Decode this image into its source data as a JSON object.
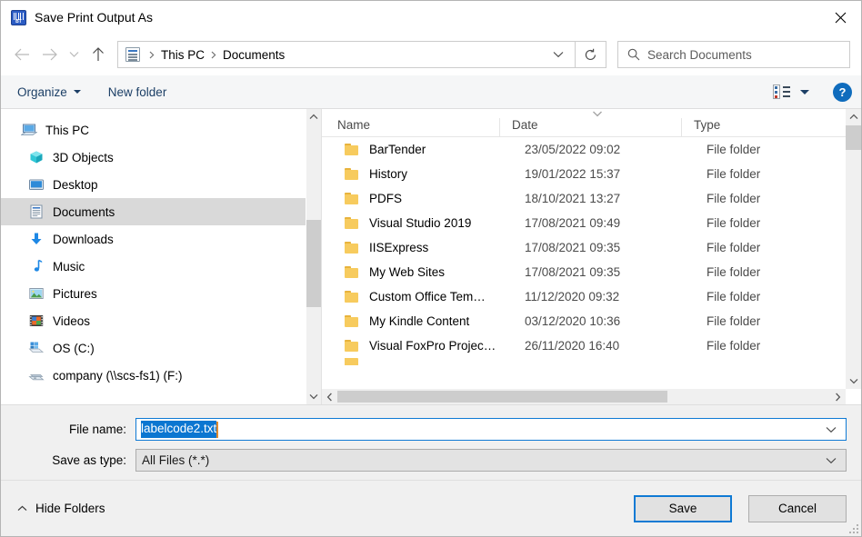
{
  "window": {
    "title": "Save Print Output As",
    "icon": "bartender-icon",
    "close_label": "✕"
  },
  "nav": {
    "back_icon": "arrow-left-icon",
    "forward_icon": "arrow-right-icon",
    "recent_icon": "chevron-down-icon",
    "up_icon": "arrow-up-icon",
    "breadcrumb": {
      "folder_icon": "documents-icon",
      "items": [
        "This PC",
        "Documents"
      ],
      "separator": "›",
      "dropdown_icon": "chevron-down-icon"
    },
    "refresh_icon": "refresh-icon",
    "search": {
      "icon": "search-icon",
      "placeholder": "Search Documents",
      "value": ""
    }
  },
  "toolbar": {
    "organize_label": "Organize",
    "new_folder_label": "New folder",
    "view_icon": "details-view-icon",
    "view_dropdown_icon": "chevron-down-icon",
    "help_label": "?"
  },
  "sidebar": {
    "items": [
      {
        "label": "This PC",
        "icon": "this-pc-icon",
        "selected": false,
        "root": true
      },
      {
        "label": "3D Objects",
        "icon": "3d-objects-icon",
        "selected": false,
        "root": false
      },
      {
        "label": "Desktop",
        "icon": "desktop-icon",
        "selected": false,
        "root": false
      },
      {
        "label": "Documents",
        "icon": "documents-icon",
        "selected": true,
        "root": false
      },
      {
        "label": "Downloads",
        "icon": "downloads-icon",
        "selected": false,
        "root": false
      },
      {
        "label": "Music",
        "icon": "music-icon",
        "selected": false,
        "root": false
      },
      {
        "label": "Pictures",
        "icon": "pictures-icon",
        "selected": false,
        "root": false
      },
      {
        "label": "Videos",
        "icon": "videos-icon",
        "selected": false,
        "root": false
      },
      {
        "label": "OS (C:)",
        "icon": "local-disk-icon",
        "selected": false,
        "root": false
      },
      {
        "label": "company (\\\\scs-fs1) (F:)",
        "icon": "network-drive-icon",
        "selected": false,
        "root": false
      }
    ],
    "scroll_up_icon": "chevron-up-icon",
    "scroll_down_icon": "chevron-down-icon"
  },
  "filelist": {
    "columns": [
      "Name",
      "Date",
      "Type"
    ],
    "sort_indicator_icon": "sort-descending-icon",
    "rows": [
      {
        "name": "BarTender",
        "date": "23/05/2022 09:02",
        "type": "File folder"
      },
      {
        "name": "History",
        "date": "19/01/2022 15:37",
        "type": "File folder"
      },
      {
        "name": "PDFS",
        "date": "18/10/2021 13:27",
        "type": "File folder"
      },
      {
        "name": "Visual Studio 2019",
        "date": "17/08/2021 09:49",
        "type": "File folder"
      },
      {
        "name": "IISExpress",
        "date": "17/08/2021 09:35",
        "type": "File folder"
      },
      {
        "name": "My Web Sites",
        "date": "17/08/2021 09:35",
        "type": "File folder"
      },
      {
        "name": "Custom Office Tem…",
        "date": "11/12/2020 09:32",
        "type": "File folder"
      },
      {
        "name": "My Kindle Content",
        "date": "03/12/2020 10:36",
        "type": "File folder"
      },
      {
        "name": "Visual FoxPro Projec…",
        "date": "26/11/2020 16:40",
        "type": "File folder"
      }
    ],
    "hscroll_left_icon": "chevron-left-icon",
    "hscroll_right_icon": "chevron-right-icon",
    "vscroll_up_icon": "chevron-up-icon",
    "vscroll_down_icon": "chevron-down-icon"
  },
  "form": {
    "filename_label": "File name:",
    "filename_value": "labelcode2.txt",
    "filename_dropdown_icon": "chevron-down-icon",
    "filetype_label": "Save as type:",
    "filetype_value": "All Files (*.*)",
    "filetype_dropdown_icon": "chevron-down-icon"
  },
  "footer": {
    "hide_folders_label": "Hide Folders",
    "hide_folders_icon": "chevron-up-icon",
    "save_label": "Save",
    "cancel_label": "Cancel",
    "resize_grip_icon": "resize-grip-icon"
  },
  "colors": {
    "accent": "#0b76d1",
    "focus_border": "#0f7ad4",
    "selection_bg": "#0b76d1",
    "caret": "#e08a2e",
    "toolbar_link": "#1c3f66",
    "sidebar_selected": "#d9d9d9",
    "folder_yellow": "#f7cb5e",
    "help_blue": "#0f6cbd"
  }
}
